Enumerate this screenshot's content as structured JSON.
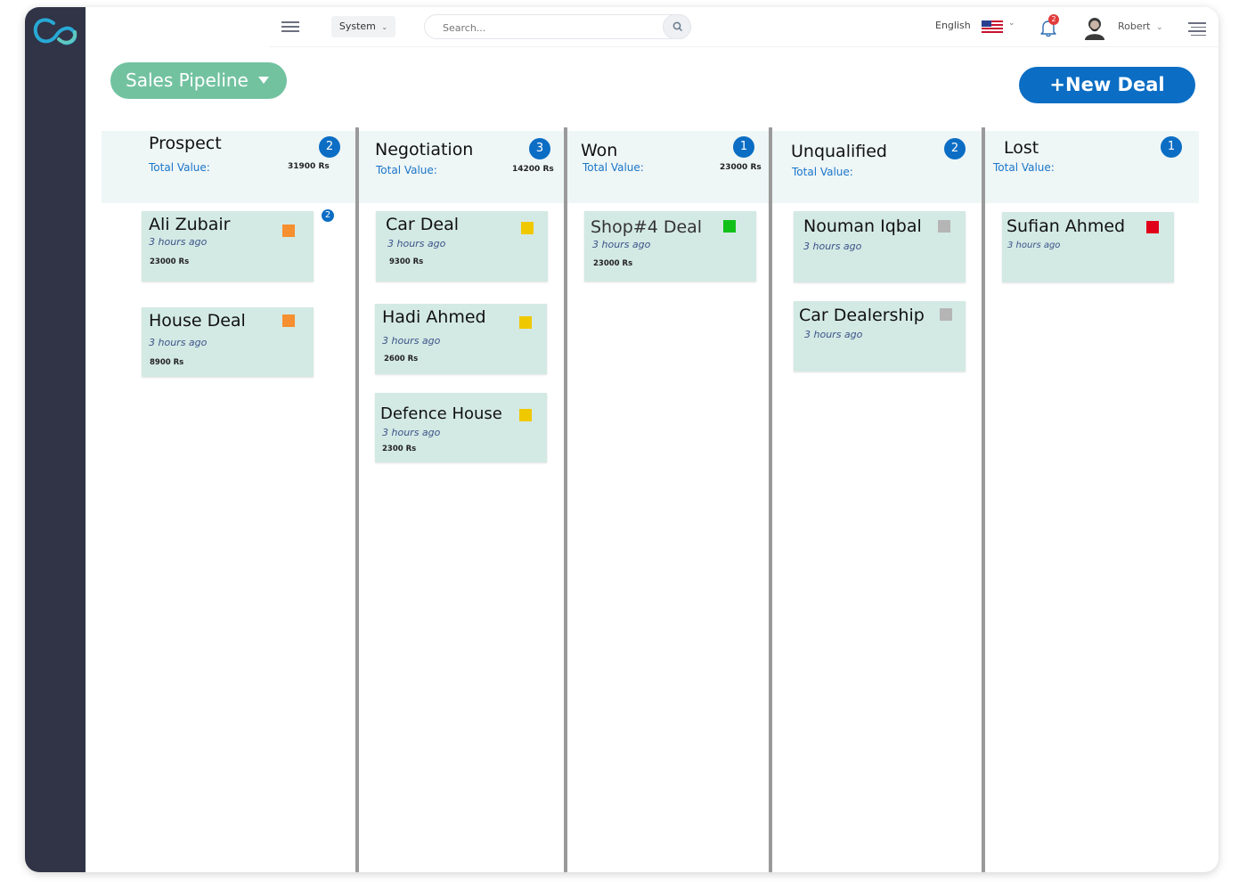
{
  "colors": {
    "sidebar": "#303446",
    "accent_blue": "#0b6dc4",
    "pipeline_green": "#72c2a0",
    "card_bg": "#d3e9e4",
    "header_band": "#eef6f6",
    "tag_orange": "#f58f2f",
    "tag_yellow": "#f0c800",
    "tag_green": "#11c11a",
    "tag_gray": "#b5b5b5",
    "tag_red": "#e0001a"
  },
  "topbar": {
    "system_label": "System",
    "search_placeholder": "Search...",
    "language": "English",
    "notification_count": "2",
    "user_name": "Robert"
  },
  "pipeline": {
    "label": "Sales Pipeline"
  },
  "actions": {
    "new_deal": "+New Deal"
  },
  "columns": [
    {
      "title": "Prospect",
      "total_label": "Total Value:",
      "total": "31900 Rs",
      "count": "2",
      "cards": [
        {
          "title": "Ali Zubair",
          "time": "3 hours ago",
          "amount": "23000 Rs",
          "tag": "orange",
          "badge": "2"
        },
        {
          "title": "House Deal",
          "time": "3 hours ago",
          "amount": "8900 Rs",
          "tag": "orange"
        }
      ]
    },
    {
      "title": "Negotiation",
      "total_label": "Total Value:",
      "total": "14200 Rs",
      "count": "3",
      "cards": [
        {
          "title": "Car Deal",
          "time": "3 hours ago",
          "amount": "9300 Rs",
          "tag": "yellow"
        },
        {
          "title": "Hadi Ahmed",
          "time": "3 hours ago",
          "amount": "2600 Rs",
          "tag": "yellow"
        },
        {
          "title": "Defence House",
          "time": "3 hours ago",
          "amount": "2300 Rs",
          "tag": "yellow"
        }
      ]
    },
    {
      "title": "Won",
      "total_label": "Total Value:",
      "total": "23000 Rs",
      "count": "1",
      "cards": [
        {
          "title": "Shop#4 Deal",
          "time": "3 hours ago",
          "amount": "23000 Rs",
          "tag": "green"
        }
      ]
    },
    {
      "title": "Unqualified",
      "total_label": "Total Value:",
      "count": "2",
      "cards": [
        {
          "title": "Nouman Iqbal",
          "time": "3 hours ago",
          "tag": "gray"
        },
        {
          "title": "Car Dealership",
          "time": "3 hours ago",
          "tag": "gray"
        }
      ]
    },
    {
      "title": "Lost",
      "total_label": "Total Value:",
      "count": "1",
      "cards": [
        {
          "title": "Sufian Ahmed",
          "time": "3 hours ago",
          "tag": "red"
        }
      ]
    }
  ]
}
